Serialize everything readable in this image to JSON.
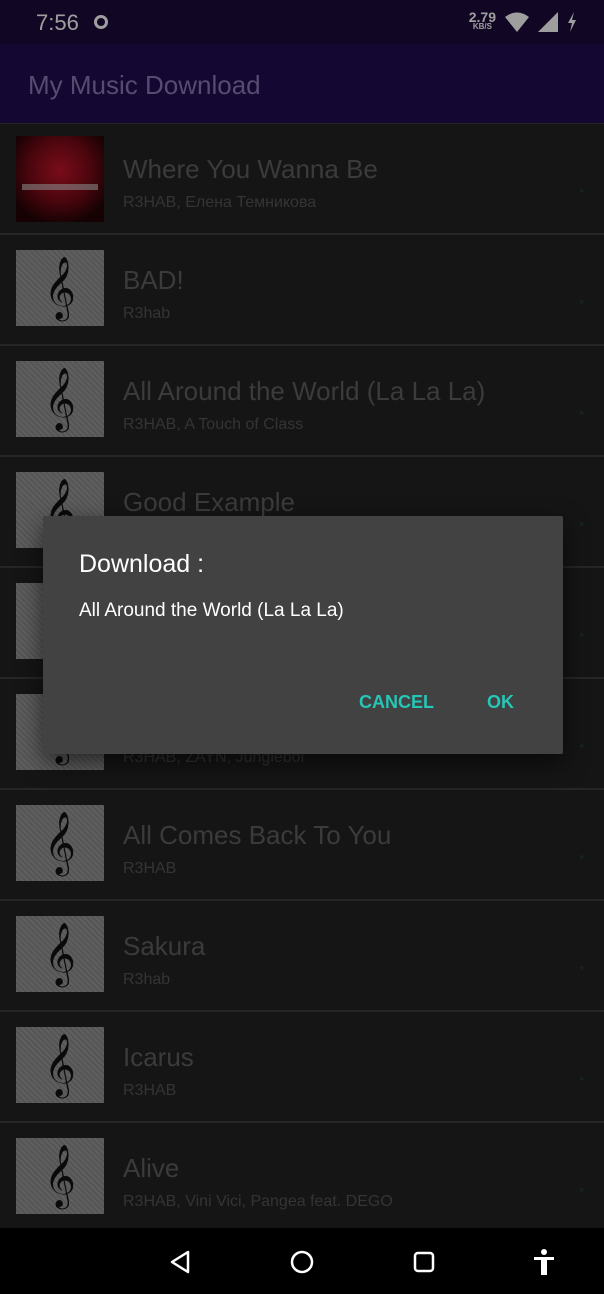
{
  "status_bar": {
    "time": "7:56",
    "net_speed_value": "2.79",
    "net_speed_unit": "KB/S",
    "icons": [
      "record-icon",
      "wifi-icon",
      "signal-icon",
      "charging-icon"
    ]
  },
  "app_bar": {
    "title": "My Music Download"
  },
  "songs": [
    {
      "title": "Where You Wanna Be",
      "artist": "R3HAB, Елена Темникова",
      "star": "*",
      "thumb": "album-art"
    },
    {
      "title": "BAD!",
      "artist": "R3hab",
      "star": "*",
      "thumb": "music-clef-icon"
    },
    {
      "title": "All Around the World (La La La)",
      "artist": "R3HAB, A Touch of Class",
      "star": "*",
      "thumb": "music-clef-icon"
    },
    {
      "title": "Good Example",
      "artist": "",
      "star": "*",
      "thumb": "music-clef-icon"
    },
    {
      "title": "",
      "artist": "",
      "star": "*",
      "thumb": "music-clef-icon"
    },
    {
      "title": "",
      "artist": "R3HAB, ZAYN, Jungleboi",
      "star": "*",
      "thumb": "music-clef-icon"
    },
    {
      "title": "All Comes Back To You",
      "artist": "R3HAB",
      "star": "*",
      "thumb": "music-clef-icon"
    },
    {
      "title": "Sakura",
      "artist": "R3hab",
      "star": "*",
      "thumb": "music-clef-icon"
    },
    {
      "title": "Icarus",
      "artist": "R3HAB",
      "star": "*",
      "thumb": "music-clef-icon"
    },
    {
      "title": "Alive",
      "artist": "R3HAB, Vini Vici, Pangea feat. DEGO",
      "star": "*",
      "thumb": "music-clef-icon"
    }
  ],
  "dialog": {
    "title": "Download :",
    "message": "All Around the World (La La La)",
    "cancel_label": "CANCEL",
    "ok_label": "OK"
  },
  "nav_bar": {
    "icons": [
      "back-icon",
      "home-icon",
      "recents-icon",
      "accessibility-icon"
    ]
  },
  "colors": {
    "status_bar": "#1c0b3a",
    "app_bar": "#210c52",
    "dialog_bg": "#424242",
    "dialog_accent": "#26c6b6"
  }
}
